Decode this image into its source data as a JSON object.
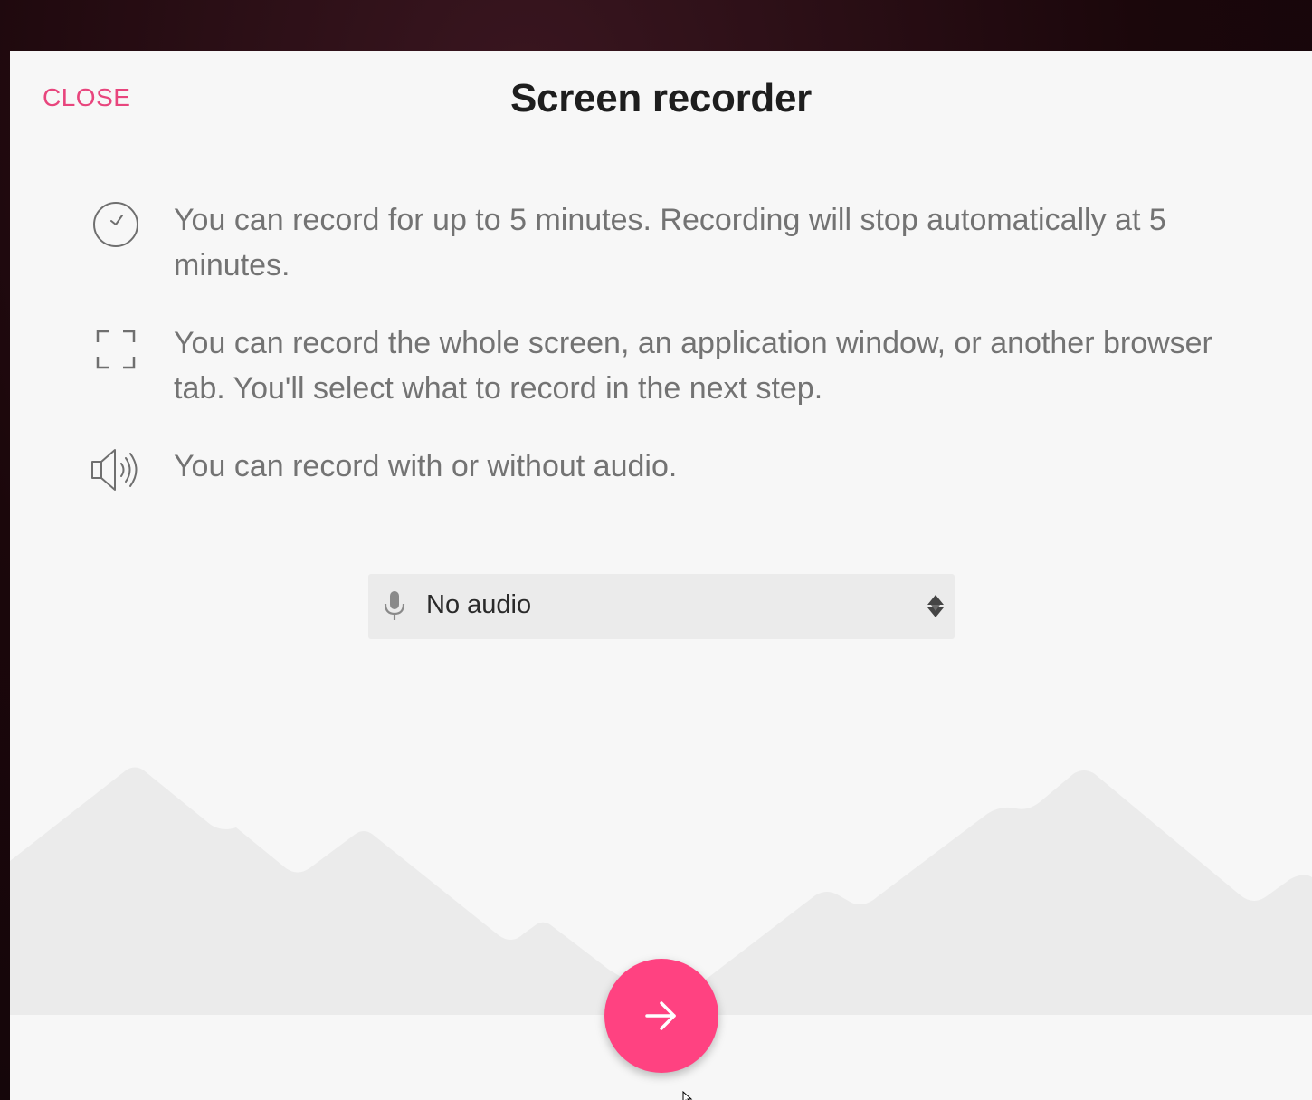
{
  "dialog": {
    "title": "Screen recorder",
    "close_label": "CLOSE"
  },
  "info": [
    {
      "icon": "clock-icon",
      "text": "You can record for up to 5 minutes. Recording will stop automatically at 5 minutes."
    },
    {
      "icon": "fullscreen-icon",
      "text": "You can record the whole screen, an application window, or another browser tab. You'll select what to record in the next step."
    },
    {
      "icon": "speaker-icon",
      "text": "You can record with or without audio."
    }
  ],
  "audio_select": {
    "icon": "microphone-icon",
    "value": "No audio"
  },
  "next_button": {
    "icon": "arrow-right-icon"
  },
  "colors": {
    "accent": "#e8457d",
    "button": "#ff4281",
    "dialog_background": "#f7f7f7",
    "mountains": "#ececec"
  }
}
